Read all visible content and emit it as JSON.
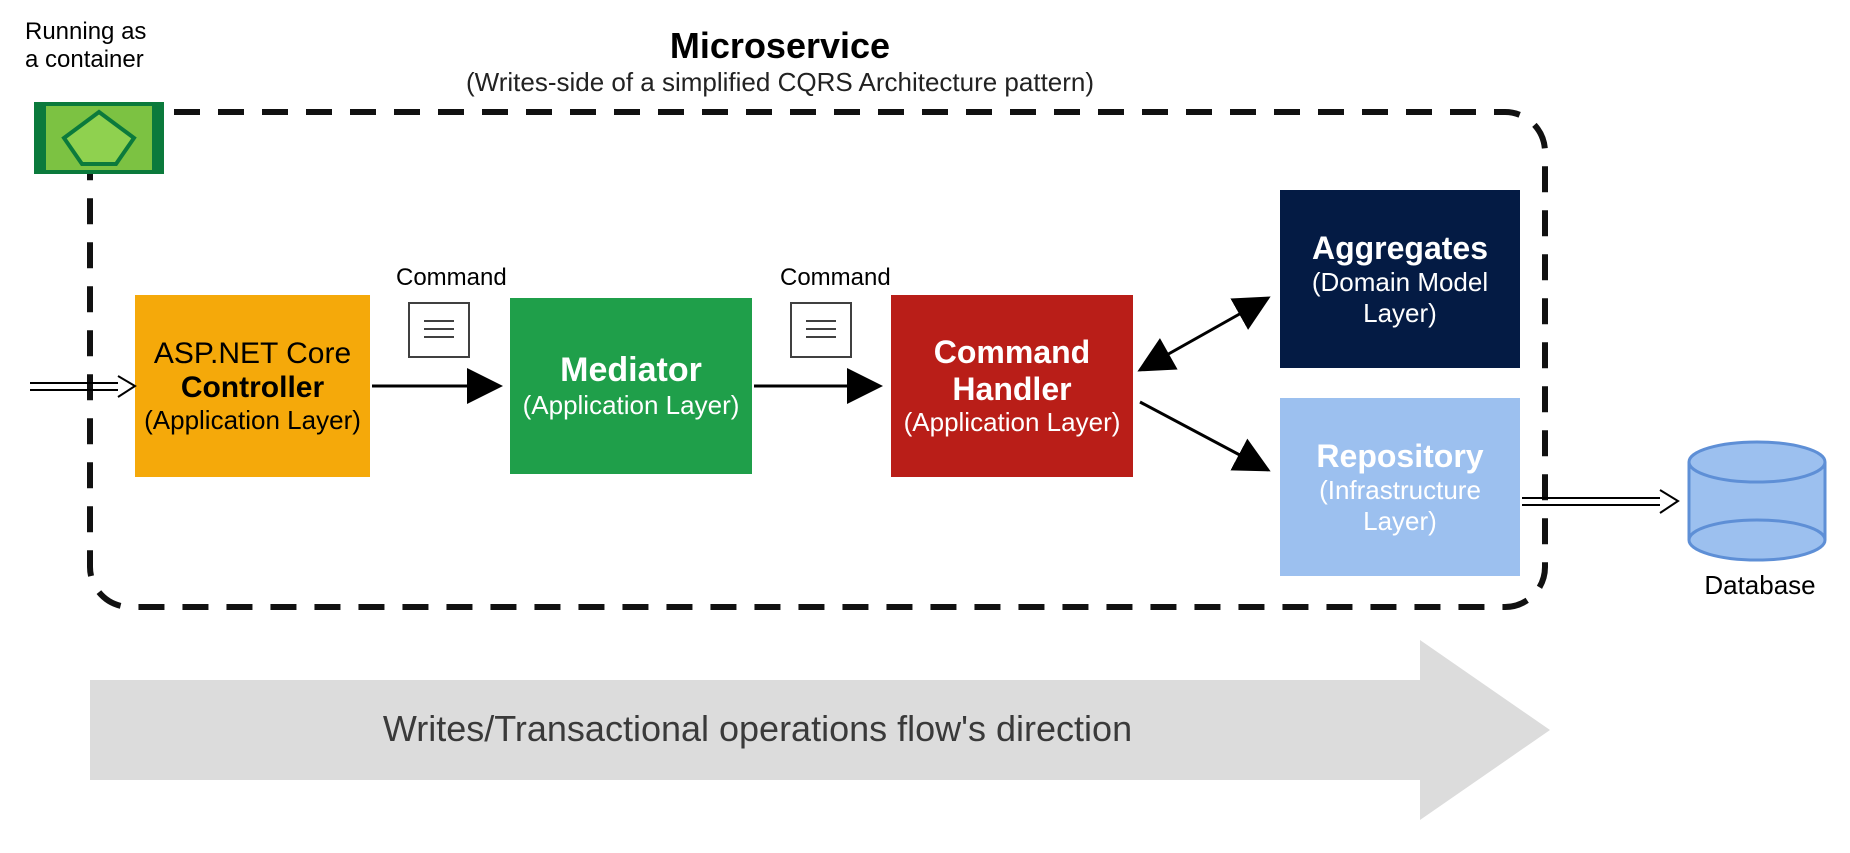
{
  "annotations": {
    "containerNote": "Running as\na container",
    "command1": "Command",
    "command2": "Command",
    "dbLabel": "Database"
  },
  "header": {
    "title": "Microservice",
    "subtitle": "(Writes-side of a simplified CQRS Architecture pattern)"
  },
  "boxes": {
    "controller": {
      "line1": "ASP.NET Core",
      "line2": "Controller",
      "sub": "(Application Layer)"
    },
    "mediator": {
      "title": "Mediator",
      "sub": "(Application Layer)"
    },
    "handler": {
      "title": "Command Handler",
      "sub": "(Application Layer)"
    },
    "aggregates": {
      "title": "Aggregates",
      "sub": "(Domain Model Layer)"
    },
    "repository": {
      "title": "Repository",
      "sub": "(Infrastructure Layer)"
    }
  },
  "flow": {
    "caption": "Writes/Transactional operations flow's direction"
  },
  "colors": {
    "controller": "#f5a90a",
    "mediator": "#1f9f4a",
    "handler": "#b91e18",
    "aggregates": "#041b44",
    "repository": "#9cc0ef",
    "containerFill": "#7cc242",
    "containerStroke": "#0b7a3c",
    "flowBar": "#dcdcdc",
    "dbFill": "#9cc0ef",
    "dbStroke": "#5e8fd6"
  }
}
